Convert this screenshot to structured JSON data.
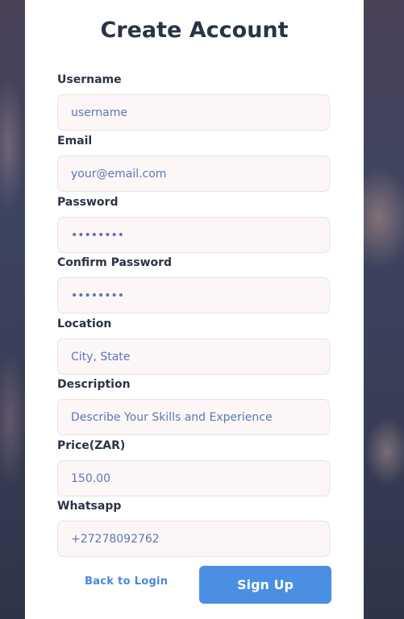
{
  "form": {
    "title": "Create Account",
    "fields": [
      {
        "label": "Username",
        "placeholder": "username",
        "value": ""
      },
      {
        "label": "Email",
        "placeholder": "your@email.com",
        "value": ""
      },
      {
        "label": "Password",
        "placeholder": "",
        "value": "••••••••"
      },
      {
        "label": "Confirm Password",
        "placeholder": "",
        "value": "••••••••"
      },
      {
        "label": "Location",
        "placeholder": "City, State",
        "value": ""
      },
      {
        "label": "Description",
        "placeholder": "Describe Your Skills and Experience",
        "value": ""
      },
      {
        "label": "Price(ZAR)",
        "placeholder": "150.00",
        "value": ""
      },
      {
        "label": "Whatsapp",
        "placeholder": "+27278092762",
        "value": ""
      }
    ],
    "back_label": "Back to Login",
    "submit_label": "Sign Up"
  },
  "colors": {
    "accent": "#4a8fe2",
    "input_bg": "#fcf6f6",
    "title": "#2a3446"
  }
}
